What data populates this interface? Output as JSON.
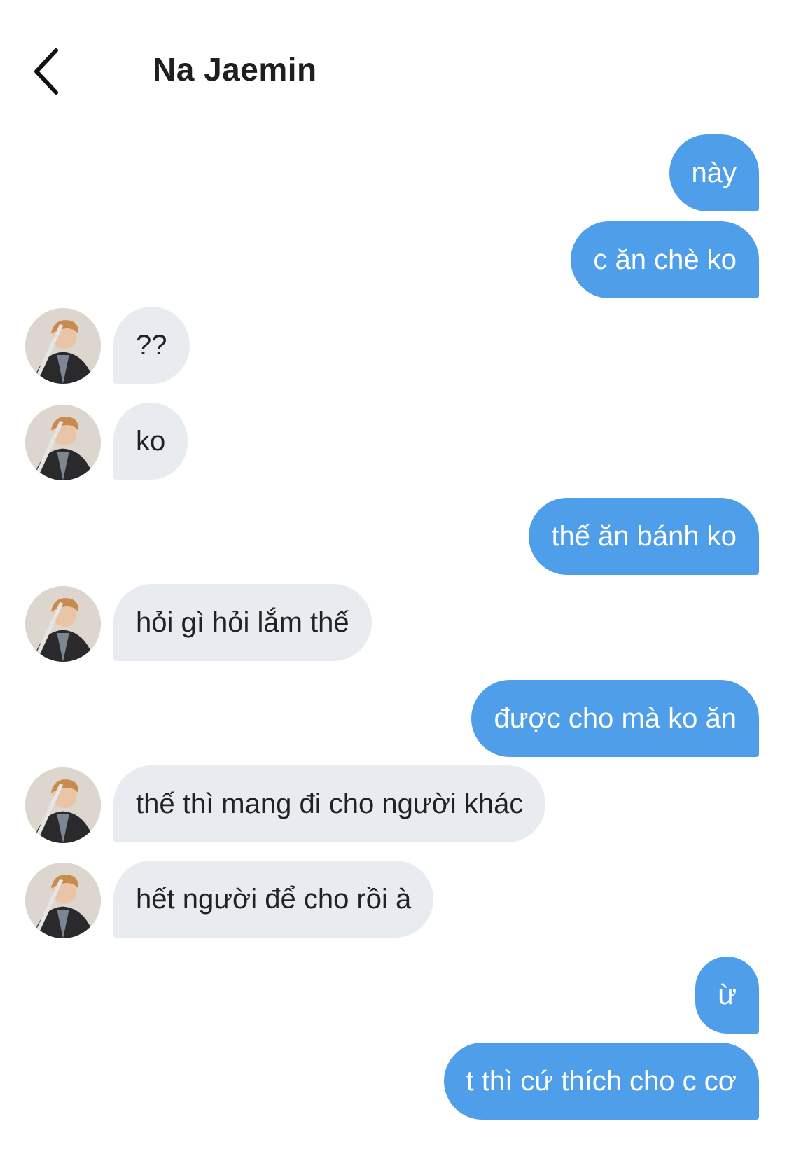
{
  "header": {
    "title": "Na Jaemin",
    "back_icon": "chevron-left-icon"
  },
  "colors": {
    "outgoing_bubble": "#4f9eea",
    "incoming_bubble": "#e8ebef",
    "background": "#ffffff"
  },
  "messages": [
    {
      "side": "out",
      "text": "này"
    },
    {
      "side": "out",
      "text": "c ăn chè ko"
    },
    {
      "side": "in",
      "text": "??"
    },
    {
      "side": "in",
      "text": "ko"
    },
    {
      "side": "out",
      "text": "thế ăn bánh ko"
    },
    {
      "side": "in",
      "text": "hỏi gì hỏi lắm thế"
    },
    {
      "side": "out",
      "text": "được cho mà ko ăn"
    },
    {
      "side": "in",
      "text": "thế thì mang đi cho người khác"
    },
    {
      "side": "in",
      "text": "hết người để cho rồi à"
    },
    {
      "side": "out",
      "text": "ừ"
    },
    {
      "side": "out",
      "text": "t thì cứ thích cho c cơ"
    }
  ]
}
